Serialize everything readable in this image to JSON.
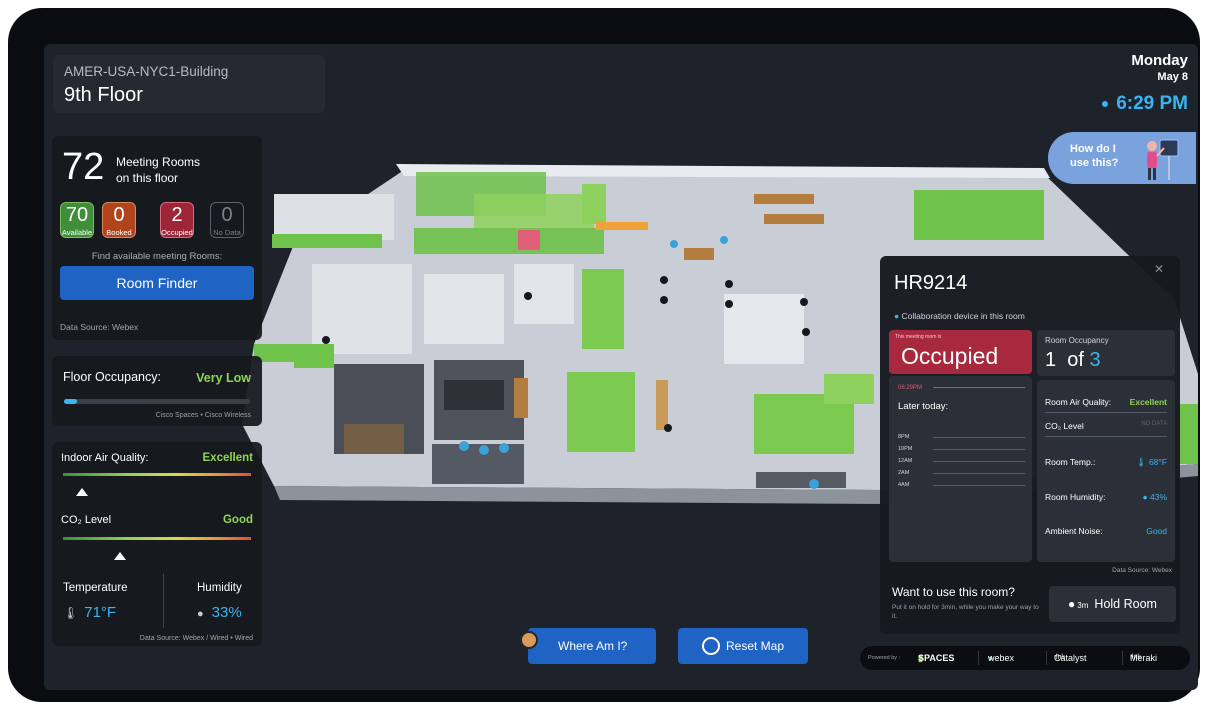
{
  "header": {
    "building": "AMER-USA-NYC1-Building",
    "floor": "9th Floor",
    "day": "Monday",
    "date": "May 8",
    "time": "6:29 PM"
  },
  "help": {
    "label": "How do I use this?"
  },
  "rooms": {
    "total": "72",
    "label_line1": "Meeting Rooms",
    "label_line2": "on this floor",
    "available": {
      "count": "70",
      "label": "Available"
    },
    "booked": {
      "count": "0",
      "label": "Booked"
    },
    "occupied": {
      "count": "2",
      "label": "Occupied"
    },
    "no_data": {
      "count": "0",
      "label": "No Data"
    },
    "find_label": "Find available meeting Rooms:",
    "finder_button": "Room Finder",
    "source": "Data Source: Webex"
  },
  "occupancy": {
    "label": "Floor Occupancy:",
    "value": "Very Low",
    "level": 0.07,
    "source": "Cisco Spaces • Cisco Wireless"
  },
  "air": {
    "iaq_label": "Indoor Air Quality:",
    "iaq_value": "Excellent",
    "co2_label": "CO₂ Level",
    "co2_value": "Good",
    "temp_label": "Temperature",
    "temp_value": "71°F",
    "humidity_label": "Humidity",
    "humidity_value": "33%",
    "source": "Data Source: Webex / Wired • Wired"
  },
  "room": {
    "name": "HR9214",
    "collab": "Collaboration device in this room",
    "status_small": "This meeting room is",
    "status": "Occupied",
    "now_time": "06:29PM",
    "later": "Later today:",
    "hours": [
      "8PM",
      "10PM",
      "12AM",
      "2AM",
      "4AM"
    ],
    "occupancy_label": "Room Occupancy",
    "occupancy_count": "1",
    "occupancy_of": "of",
    "occupancy_capacity": "3",
    "air_quality_label": "Room Air Quality:",
    "air_quality_value": "Excellent",
    "co2_label": "CO₂ Level",
    "co2_value": "NO DATA",
    "temp_label": "Room Temp.:",
    "temp_value": "68°F",
    "humidity_label": "Room Humidity:",
    "humidity_value": "43%",
    "noise_label": "Ambient Noise:",
    "noise_value": "Good",
    "source": "Data Source: Webex",
    "want_title": "Want to use this room?",
    "want_sub": "Put it on hold for 3min, while you make your way to it.",
    "hold_button": "Hold Room",
    "hold_minutes": "3m"
  },
  "buttons": {
    "where": "Where Am I?",
    "reset": "Reset Map"
  },
  "powered": {
    "label": "Powered by :",
    "spaces": "SPACES",
    "webex": "webex",
    "catalyst": "Catalyst",
    "meraki": "Meraki"
  },
  "colors": {
    "accent": "#38b4f0",
    "available": "#3f8e3a",
    "booked": "#b1441c",
    "occupied": "#a8293e",
    "good": "#8ed455",
    "button": "#1f63c5"
  }
}
